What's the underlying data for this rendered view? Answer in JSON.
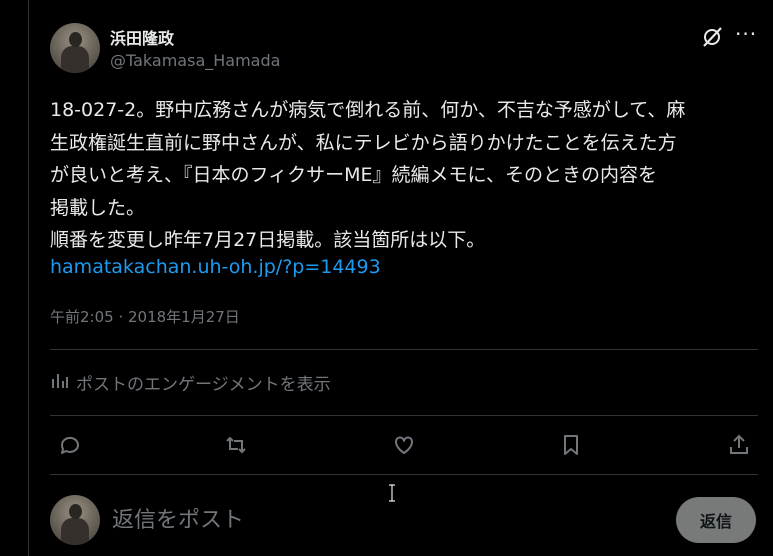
{
  "post": {
    "display_name": "浜田隆政",
    "handle": "@Takamasa_Hamada",
    "text": "18-027-2。野中広務さんが病気で倒れる前、何か、不吉な予感がして、麻\n生政権誕生直前に野中さんが、私にテレビから語りかけたことを伝えた方\nが良いと考え、『日本のフィクサーME』続編メモに、そのときの内容を\n掲載した。\n順番を変更し昨年7月27日掲載。該当箇所は以下。",
    "link": "hamatakachan.uh-oh.jp/?p=14493",
    "timestamp": "午前2:05 · 2018年1月27日"
  },
  "engagement": {
    "label": "ポストのエンゲージメントを表示"
  },
  "reply": {
    "placeholder": "返信をポスト",
    "button_label": "返信"
  },
  "colors": {
    "background": "#000000",
    "text": "#e7e9ea",
    "muted": "#71767b",
    "link": "#1d9bf0",
    "border": "#2f3336",
    "button_bg": "#787a7a"
  },
  "icons": [
    "grok-icon",
    "more-icon",
    "chart-icon",
    "reply-icon",
    "repost-icon",
    "like-icon",
    "bookmark-icon",
    "share-icon"
  ]
}
